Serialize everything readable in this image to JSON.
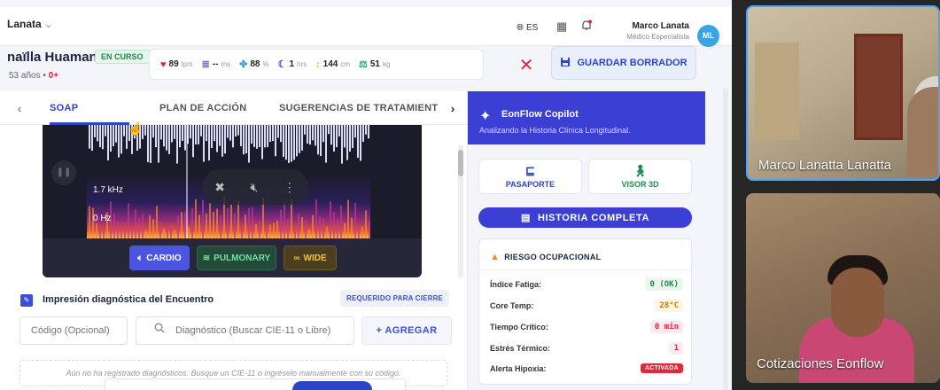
{
  "topbar": {
    "workspace": "Lanata",
    "language": "ES",
    "user_name": "Marco Lanata",
    "user_role": "Médico Especialista",
    "avatar_initials": "ML"
  },
  "patient": {
    "name": "naïlla Huaman",
    "status": "EN CURSO",
    "age": "53 años",
    "separator": "•",
    "blood_type": "0+"
  },
  "vitals": [
    {
      "icon": "heart-icon",
      "value": "89",
      "unit": "lpm",
      "color": "#e0293d"
    },
    {
      "icon": "pressure-icon",
      "value": "--",
      "unit": "ms",
      "color": "#8a5cf6"
    },
    {
      "icon": "lungs-icon",
      "value": "88",
      "unit": "%",
      "color": "#3aa3e8"
    },
    {
      "icon": "moon-icon",
      "value": "1",
      "unit": "hrs",
      "color": "#3c4ed8"
    },
    {
      "icon": "height-icon",
      "value": "144",
      "unit": "cm",
      "color": "#f0a020"
    },
    {
      "icon": "weight-icon",
      "value": "51",
      "unit": "kg",
      "color": "#1fa37a"
    }
  ],
  "actions": {
    "close_symbol": "✕",
    "save_label": "GUARDAR BORRADOR"
  },
  "tabs": {
    "items": [
      "SOAP",
      "PLAN DE ACCIÓN",
      "SUGERENCIAS DE TRATAMIENT"
    ],
    "active": "SOAP"
  },
  "audio": {
    "freq_high": "1.7 kHz",
    "freq_low": "0 Hz",
    "filters": {
      "cardio": "CARDIO",
      "pulmonary": "PULMONARY",
      "wide": "WIDE"
    }
  },
  "diagnosis": {
    "title": "Impresión diagnóstica del Encuentro",
    "required": "REQUERIDO PARA CIERRE",
    "code_placeholder": "Código (Opcional)",
    "search_placeholder": "Diagnóstico (Buscar CIE-11 o Libre)",
    "add_label": "+ AGREGAR",
    "empty_message": "Aún no ha registrado diagnósticos. Busque un CIE-11 o ingréselo manualmente con su código."
  },
  "copilot": {
    "title": "EonFlow Copilot",
    "subtitle": "Analizando la Historia Clínica Longitudinal.",
    "passport": "PASAPORTE",
    "viewer": "VISOR 3D",
    "history": "HISTORIA COMPLETA"
  },
  "risk": {
    "title": "RIESGO OCUPACIONAL",
    "rows": [
      {
        "label": "Índice Fatiga:",
        "value": "0 (OK)",
        "level": "ok"
      },
      {
        "label": "Core Temp:",
        "value": "28°C",
        "level": "warm"
      },
      {
        "label": "Tiempo Crítico:",
        "value": "0 min",
        "level": "red"
      },
      {
        "label": "Estrés Térmico:",
        "value": "1",
        "level": "red"
      },
      {
        "label": "Alerta Hipoxia:",
        "value": "ACTIVADA",
        "level": "on"
      }
    ]
  },
  "video": {
    "participant_1": "Marco Lanatta Lanatta",
    "participant_2": "Cotizaciones Eonflow"
  },
  "colors": {
    "primary": "#2c45c7",
    "copilot": "#3b3fd4",
    "danger": "#e0293d",
    "success": "#1f8a4c"
  }
}
